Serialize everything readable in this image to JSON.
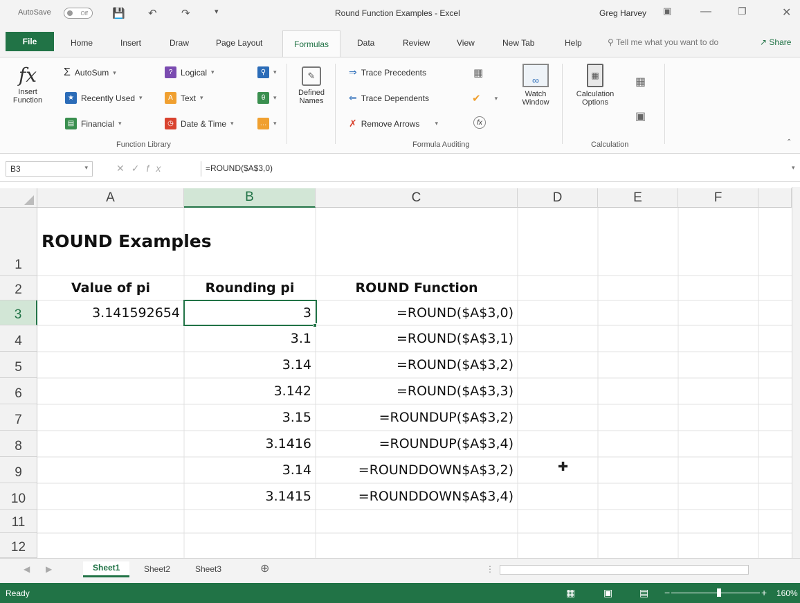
{
  "titlebar": {
    "autosave_label": "AutoSave",
    "autosave_state": "Off",
    "title": "Round Function Examples  -  Excel",
    "user": "Greg Harvey"
  },
  "tabs": {
    "file": "File",
    "home": "Home",
    "insert": "Insert",
    "draw": "Draw",
    "page_layout": "Page Layout",
    "formulas": "Formulas",
    "data": "Data",
    "review": "Review",
    "view": "View",
    "new_tab": "New Tab",
    "help": "Help",
    "tell_me": "Tell me what you want to do",
    "share": "Share"
  },
  "ribbon": {
    "insert_function": "Insert Function",
    "autosum": "AutoSum",
    "recently_used": "Recently Used",
    "financial": "Financial",
    "logical": "Logical",
    "text": "Text",
    "date_time": "Date & Time",
    "defined_names": "Defined Names",
    "trace_precedents": "Trace Precedents",
    "trace_dependents": "Trace Dependents",
    "remove_arrows": "Remove Arrows",
    "watch_window": "Watch Window",
    "calculation_options": "Calculation Options",
    "group_function_library": "Function Library",
    "group_formula_auditing": "Formula Auditing",
    "group_calculation": "Calculation"
  },
  "formula_bar": {
    "name_box": "B3",
    "formula": "=ROUND($A$3,0)"
  },
  "grid": {
    "columns": [
      "A",
      "B",
      "C",
      "D",
      "E",
      "F"
    ],
    "rows": [
      "1",
      "2",
      "3",
      "4",
      "5",
      "6",
      "7",
      "8",
      "9",
      "10",
      "11",
      "12"
    ],
    "title": "ROUND Examples",
    "headers": {
      "a": "Value of pi",
      "b": "Rounding pi",
      "c": "ROUND Function"
    },
    "a3": "3.141592654",
    "b_values": [
      "3",
      "3.1",
      "3.14",
      "3.142",
      "3.15",
      "3.1416",
      "3.14",
      "3.1415"
    ],
    "c_formulas": [
      "=ROUND($A$3,0)",
      "=ROUND($A$3,1)",
      "=ROUND($A$3,2)",
      "=ROUND($A$3,3)",
      "=ROUNDUP($A$3,2)",
      "=ROUNDUP($A$3,4)",
      "=ROUNDDOWN$A$3,2)",
      "=ROUNDDOWN$A$3,4)"
    ]
  },
  "sheets": {
    "sheet1": "Sheet1",
    "sheet2": "Sheet2",
    "sheet3": "Sheet3"
  },
  "status": {
    "ready": "Ready",
    "zoom": "160%"
  },
  "colors": {
    "accent": "#217346"
  }
}
